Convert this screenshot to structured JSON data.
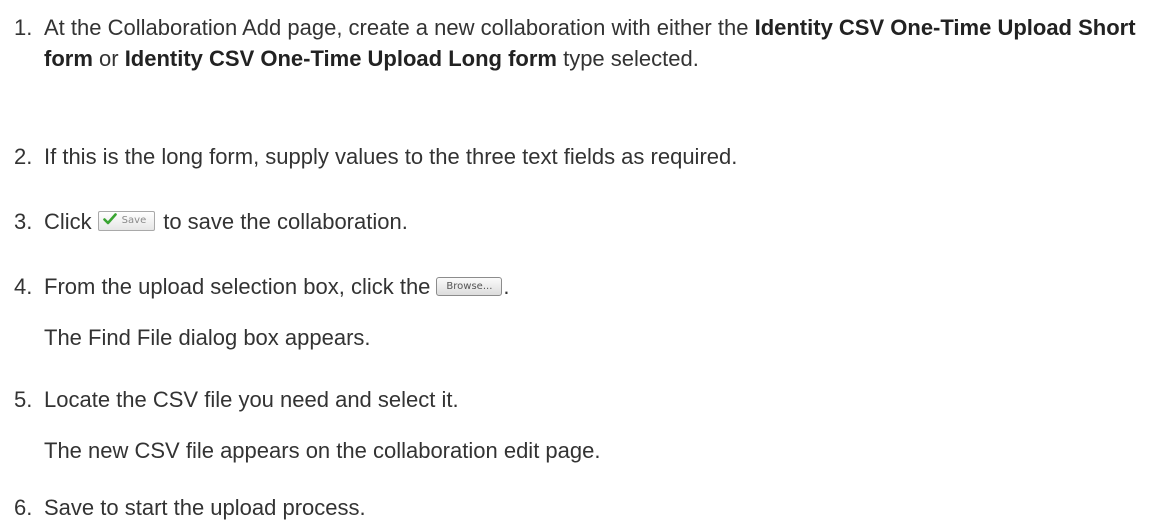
{
  "steps": [
    {
      "number": "1.",
      "pre": "At the Collaboration Add page, create a new collaboration with either the ",
      "bold1": "Identity CSV One-Time Upload Short form",
      "mid": " or ",
      "bold2": "Identity CSV One-Time Upload Long form",
      "post": " type selected."
    },
    {
      "number": "2.",
      "text": "If this is the long form, supply values to the three text fields as required."
    },
    {
      "number": "3.",
      "pre": "Click",
      "button_label": "Save",
      "post": "to save the collaboration."
    },
    {
      "number": "4.",
      "pre": "From the upload selection box, click the",
      "button_label": "Browse...",
      "post": ".",
      "note": "The Find File dialog box appears."
    },
    {
      "number": "5.",
      "text": "Locate the CSV file you need and select it.",
      "note": "The new CSV file appears on the collaboration edit page."
    },
    {
      "number": "6.",
      "text": "Save to start the upload process."
    }
  ],
  "colors": {
    "text": "#333333",
    "check": "#3aa532"
  },
  "icons": {
    "save": "checkmark-icon"
  }
}
